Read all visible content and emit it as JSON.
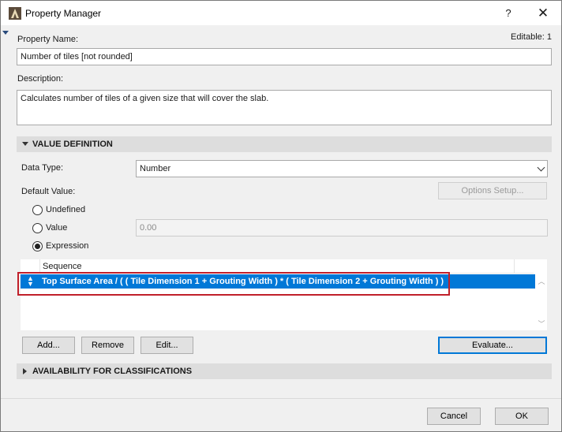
{
  "window": {
    "title": "Property Manager",
    "help_glyph": "?",
    "close_glyph": "✕"
  },
  "property_name": {
    "label": "Property Name:",
    "value": "Number of tiles [not rounded]",
    "editable_text": "Editable: 1"
  },
  "description": {
    "label": "Description:",
    "value": "Calculates number of tiles of a given size that will cover the slab."
  },
  "value_definition": {
    "header": "VALUE DEFINITION",
    "expanded": true,
    "data_type_label": "Data Type:",
    "data_type_value": "Number",
    "default_value_label": "Default Value:",
    "options_setup_button": "Options Setup...",
    "radios": [
      {
        "label": "Undefined",
        "checked": false
      },
      {
        "label": "Value",
        "checked": false
      },
      {
        "label": "Expression",
        "checked": true
      }
    ],
    "value_field": "0.00",
    "list": {
      "column_header": "Sequence",
      "rows": [
        {
          "text": "Top Surface Area / ( ( Tile Dimension 1 + Grouting Width ) * ( Tile Dimension 2 + Grouting Width ) )",
          "selected": true
        }
      ],
      "row_handle_glyph": "▴▾"
    },
    "buttons": {
      "add": "Add...",
      "remove": "Remove",
      "edit": "Edit...",
      "evaluate": "Evaluate..."
    }
  },
  "availability": {
    "header": "AVAILABILITY FOR CLASSIFICATIONS",
    "expanded": false
  },
  "footer": {
    "cancel": "Cancel",
    "ok": "OK"
  },
  "colors": {
    "selection": "#0078d7",
    "highlight_border": "#c0202a",
    "section_bar": "#dddddd"
  }
}
